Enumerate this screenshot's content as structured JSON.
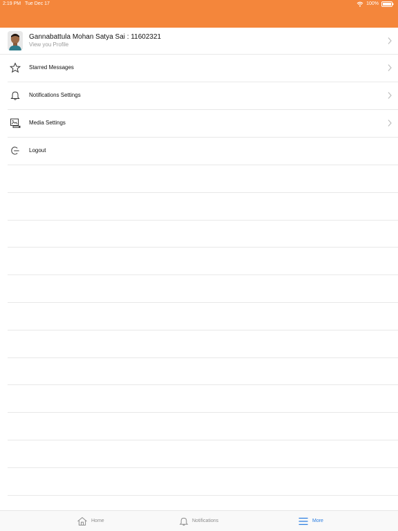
{
  "status": {
    "time": "2:19 PM",
    "date": "Tue Dec 17",
    "battery": "100%"
  },
  "profile": {
    "name": "Gannabattula Mohan Satya Sai : 11602321",
    "subtitle": "View you Profile"
  },
  "menu": {
    "items": [
      {
        "label": "Starred Messages",
        "icon": "star-icon",
        "chevron": true
      },
      {
        "label": "Notifications Settings",
        "icon": "bell-icon",
        "chevron": true
      },
      {
        "label": "Media Settings",
        "icon": "media-icon",
        "chevron": true
      },
      {
        "label": "Logout",
        "icon": "logout-icon",
        "chevron": false
      }
    ]
  },
  "tabs": {
    "home": "Home",
    "notifications": "Notifications",
    "more": "More"
  },
  "colors": {
    "accent": "#f4863b",
    "active_tab": "#2a7de1",
    "inactive": "#8d8d8d"
  }
}
